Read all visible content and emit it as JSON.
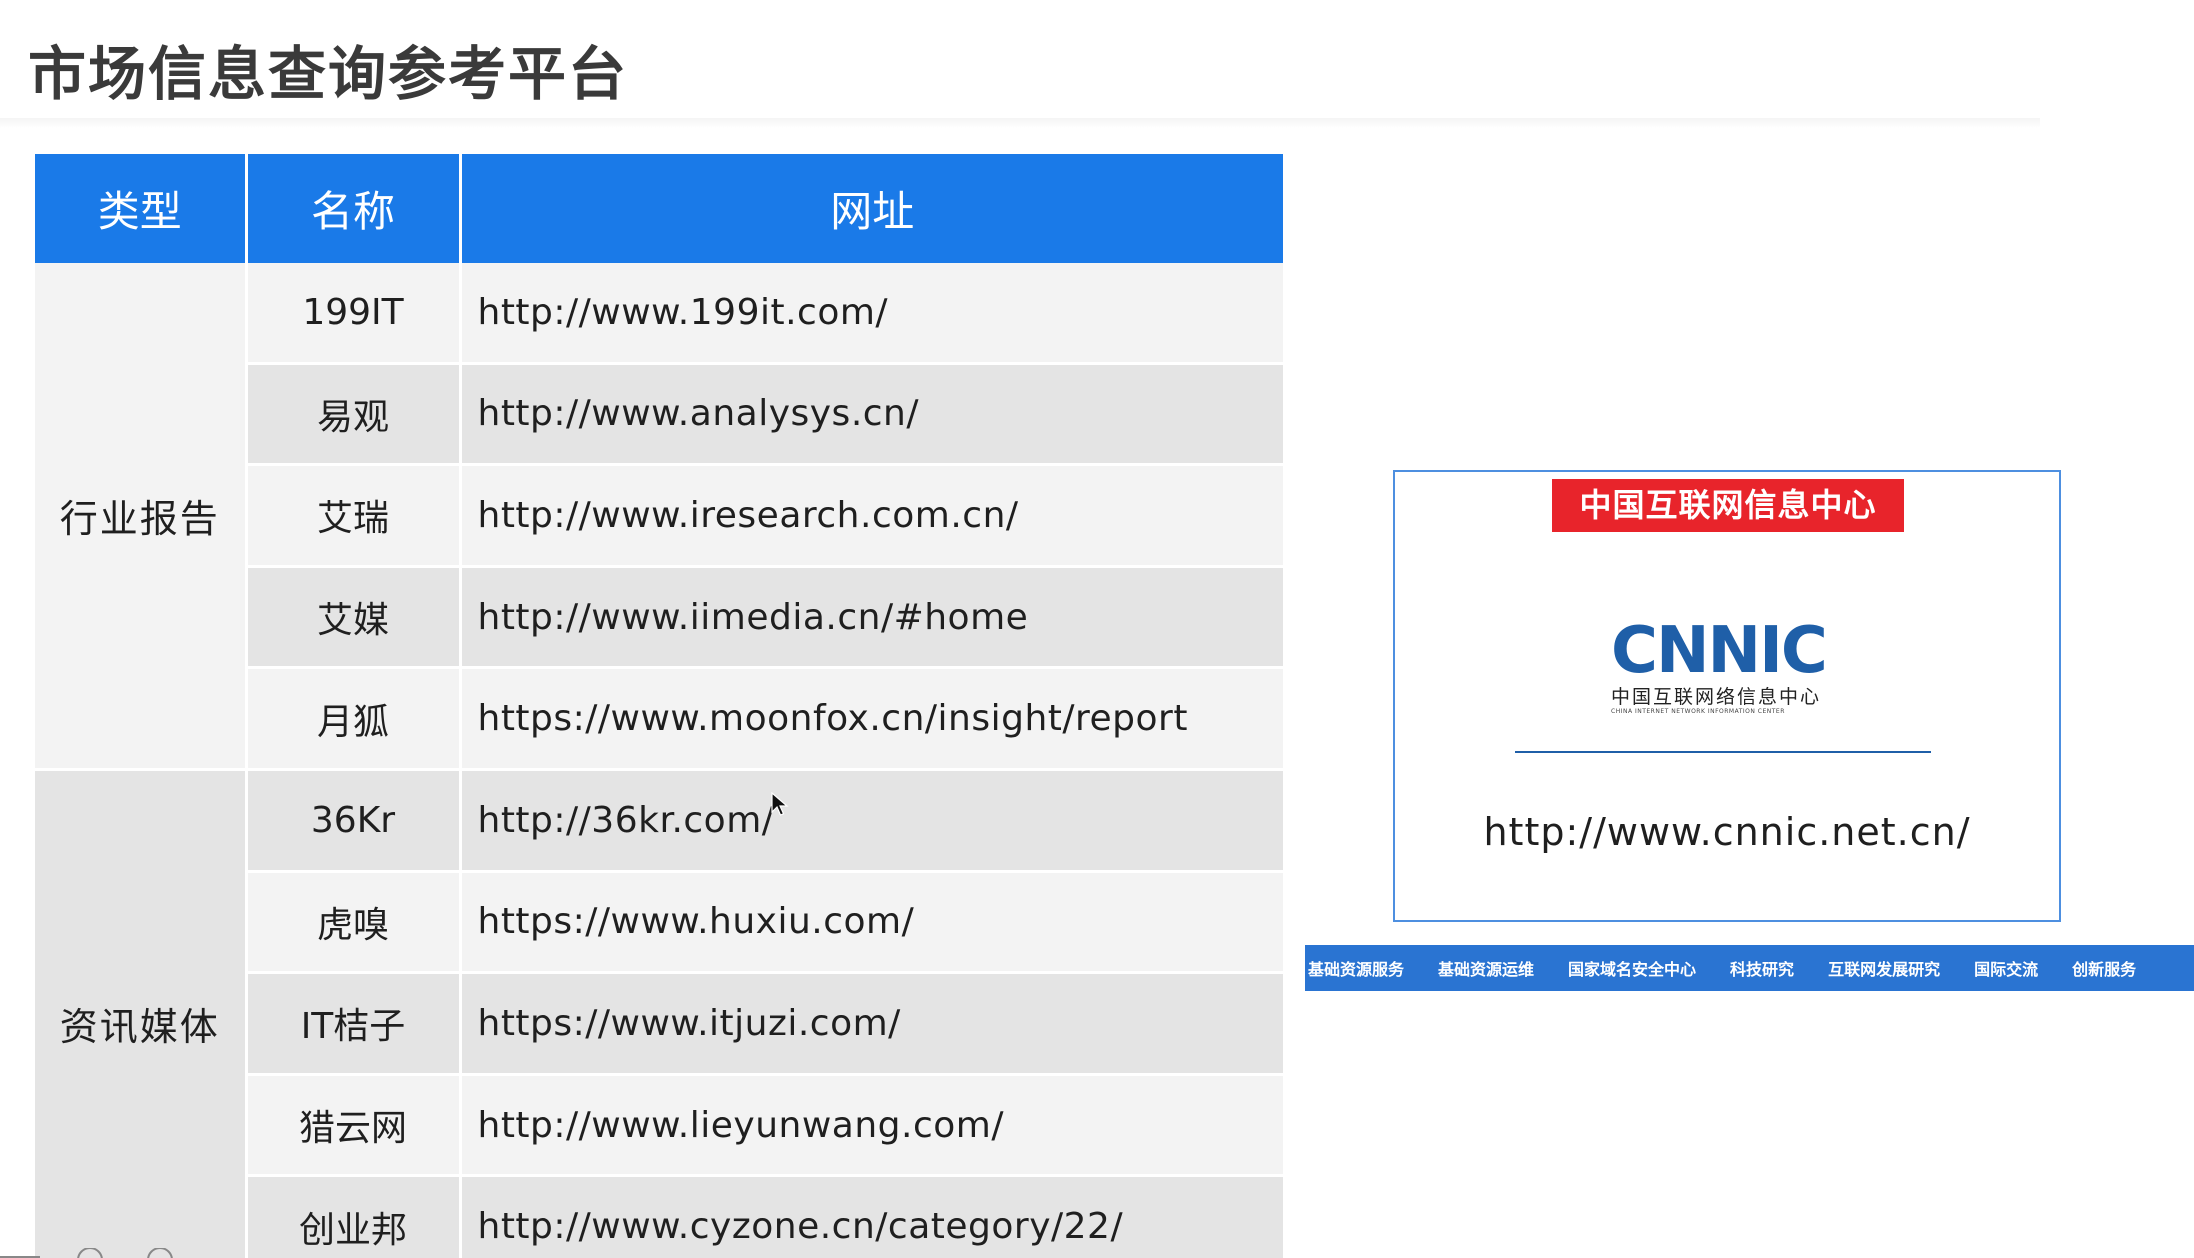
{
  "page": {
    "title": "市场信息查询参考平台"
  },
  "table": {
    "headers": [
      "类型",
      "名称",
      "网址"
    ],
    "groups": [
      {
        "type": "行业报告",
        "rows": [
          {
            "name": "199IT",
            "url": "http://www.199it.com/"
          },
          {
            "name": "易观",
            "url": "http://www.analysys.cn/"
          },
          {
            "name": "艾瑞",
            "url": "http://www.iresearch.com.cn/"
          },
          {
            "name": "艾媒",
            "url": "http://www.iimedia.cn/#home"
          },
          {
            "name": "月狐",
            "url": "https://www.moonfox.cn/insight/report"
          }
        ]
      },
      {
        "type": "资讯媒体",
        "rows": [
          {
            "name": "36Kr",
            "url": "http://36kr.com/"
          },
          {
            "name": "虎嗅",
            "url": "https://www.huxiu.com/"
          },
          {
            "name": "IT桔子",
            "url": "https://www.itjuzi.com/"
          },
          {
            "name": "猎云网",
            "url": "http://www.lieyunwang.com/"
          },
          {
            "name": "创业邦",
            "url": "http://www.cyzone.cn/category/22/"
          }
        ]
      }
    ]
  },
  "cnnic": {
    "banner": "中国互联网信息中心",
    "logo_text": "CNNIC",
    "logo_cn": "中国互联网络信息中心",
    "logo_en": "CHINA INTERNET NETWORK INFORMATION CENTER",
    "url": "http://www.cnnic.net.cn/",
    "nav": [
      "基础资源服务",
      "基础资源运维",
      "国家域名安全中心",
      "科技研究",
      "互联网发展研究",
      "国际交流",
      "创新服务"
    ]
  },
  "colors": {
    "header_blue": "#1a7ae8",
    "banner_red": "#e8242b",
    "logo_blue": "#1f5fa8",
    "nav_blue": "#2a74d2"
  }
}
